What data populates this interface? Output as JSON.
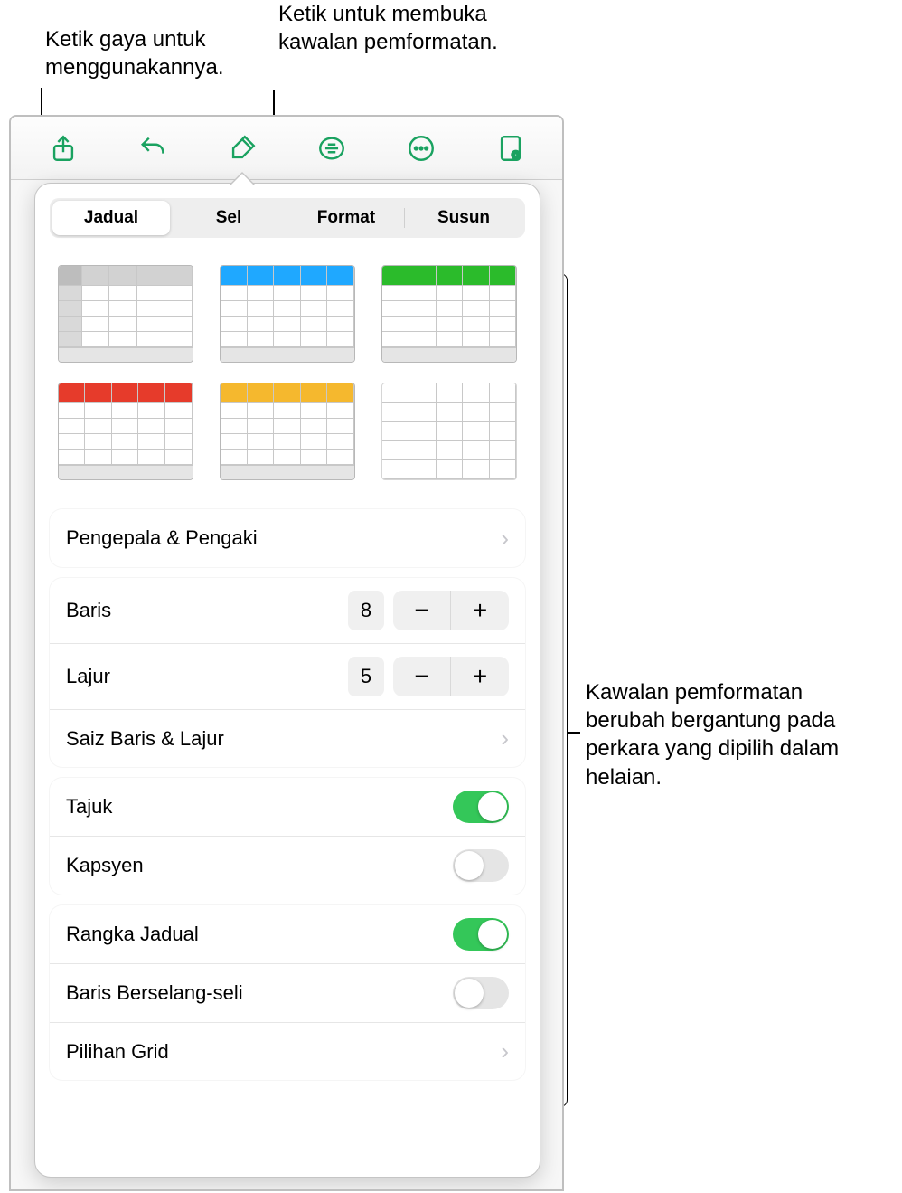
{
  "callouts": {
    "top_left": "Ketik gaya untuk menggunakannya.",
    "top_right": "Ketik untuk membuka kawalan pemformatan.",
    "side": "Kawalan pemformatan berubah bergantung pada perkara yang dipilih dalam helaian."
  },
  "toolbar": {
    "share": "share-icon",
    "undo": "undo-icon",
    "format": "format-brush-icon",
    "comment": "comment-icon",
    "more": "more-icon",
    "view": "document-view-icon"
  },
  "popover": {
    "tabs": [
      "Jadual",
      "Sel",
      "Format",
      "Susun"
    ],
    "active_tab_index": 0,
    "styles": [
      {
        "header_bg": "#d2d2d2",
        "header_side": "#d2d2d2"
      },
      {
        "header_bg": "#1fa8ff",
        "header_side": "#ffffff"
      },
      {
        "header_bg": "#2bbb2b",
        "header_side": "#ffffff"
      },
      {
        "header_bg": "#e63b2b",
        "header_side": "#ffffff"
      },
      {
        "header_bg": "#f5b82e",
        "header_side": "#ffffff"
      },
      {
        "header_bg": "#ffffff",
        "header_side": "#ffffff"
      }
    ],
    "section_headers_footers": "Pengepala & Pengaki",
    "rows_label": "Baris",
    "rows_value": "8",
    "cols_label": "Lajur",
    "cols_value": "5",
    "row_col_size": "Saiz Baris & Lajur",
    "title_label": "Tajuk",
    "title_on": true,
    "caption_label": "Kapsyen",
    "caption_on": false,
    "outline_label": "Rangka Jadual",
    "outline_on": true,
    "alternating_label": "Baris Berselang-seli",
    "alternating_on": false,
    "grid_options": "Pilihan Grid"
  }
}
